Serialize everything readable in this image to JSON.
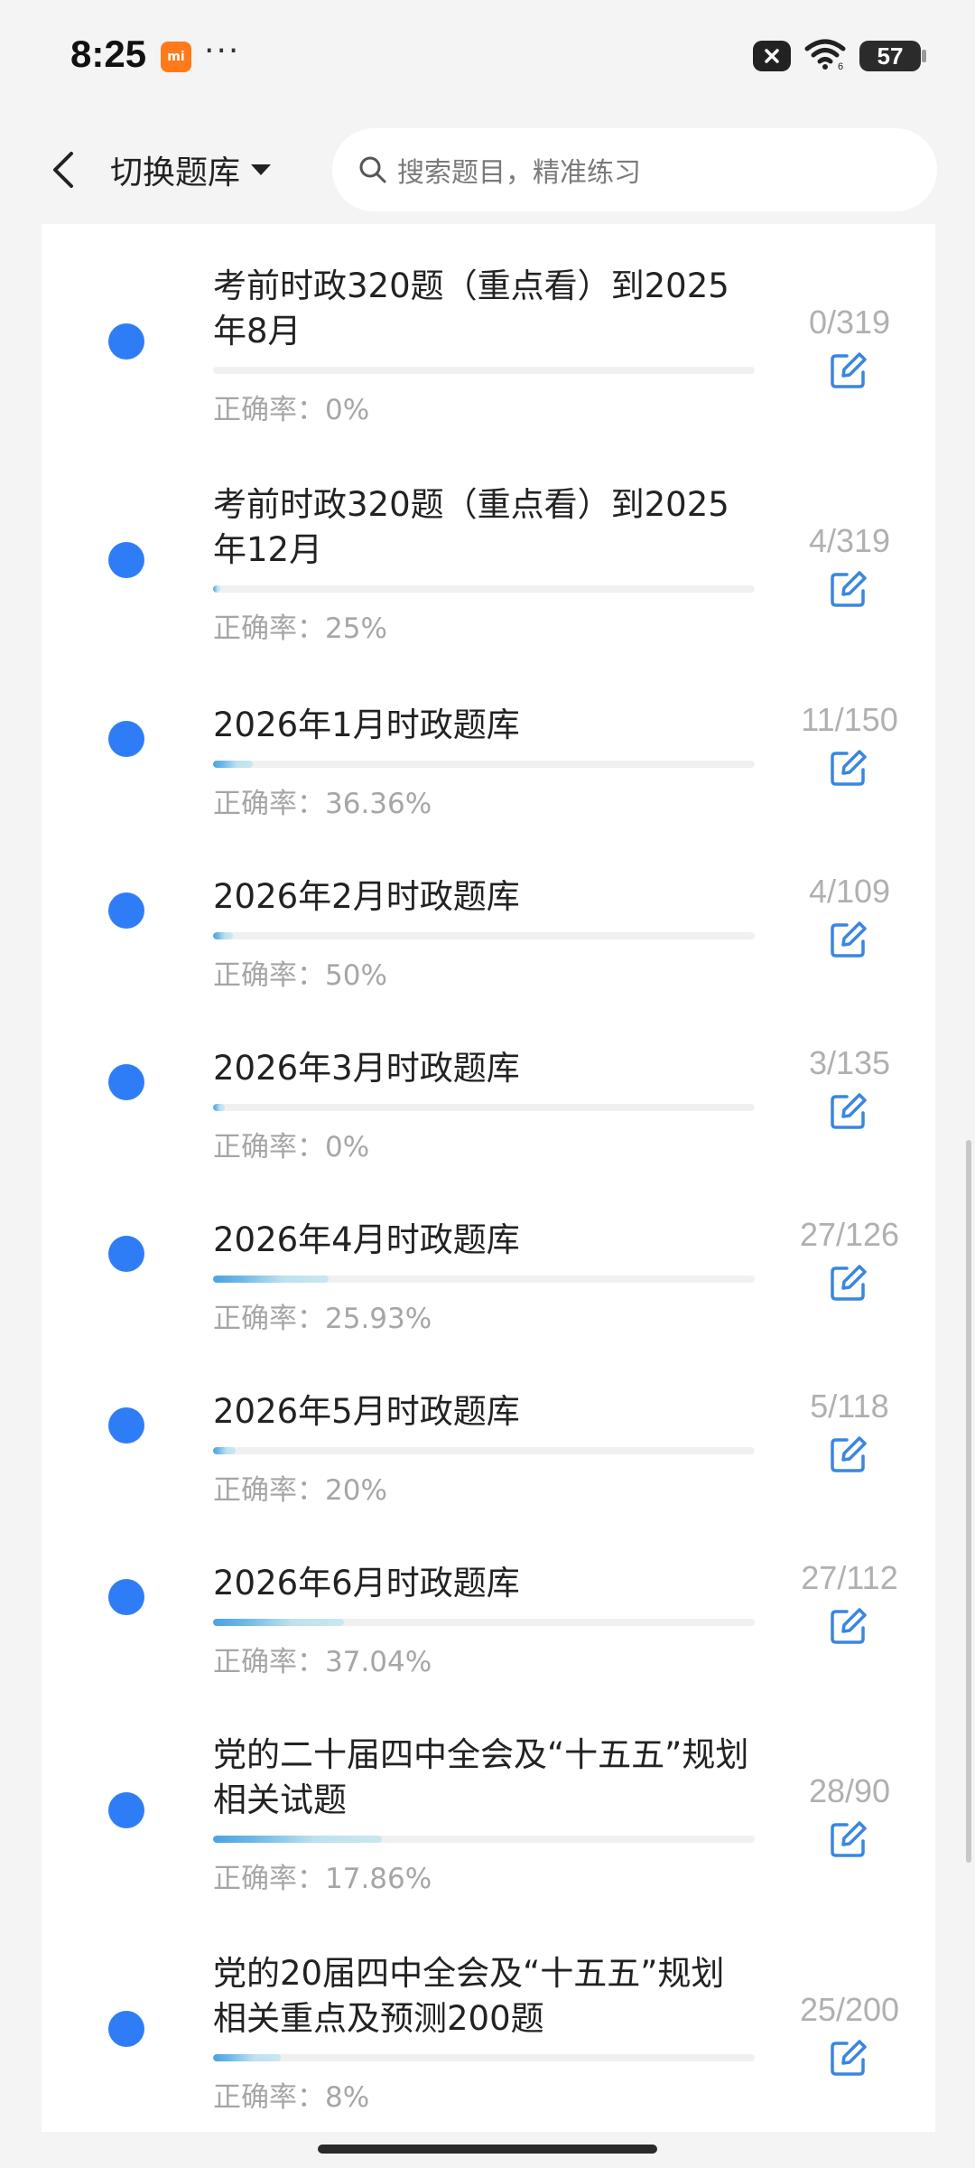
{
  "status_bar": {
    "time": "8:25",
    "app_badge_text": "mi",
    "more": "···",
    "battery": "57"
  },
  "header": {
    "switch_label": "切换题库",
    "search_placeholder": "搜索题目，精准练习"
  },
  "colors": {
    "accent_blue": "#2f7df6",
    "edit_icon_blue": "#3a86e0",
    "muted_text": "#a6a6a6"
  },
  "items": [
    {
      "title": "考前时政320题（重点看）到2025年8月",
      "accuracy": "正确率：0%",
      "count": "0/319",
      "progress": 0.0
    },
    {
      "title": "考前时政320题（重点看）到2025年12月",
      "accuracy": "正确率：25%",
      "count": "4/319",
      "progress": 0.013
    },
    {
      "title": "2026年1月时政题库",
      "accuracy": "正确率：36.36%",
      "count": "11/150",
      "progress": 0.073
    },
    {
      "title": "2026年2月时政题库",
      "accuracy": "正确率：50%",
      "count": "4/109",
      "progress": 0.037
    },
    {
      "title": "2026年3月时政题库",
      "accuracy": "正确率：0%",
      "count": "3/135",
      "progress": 0.022
    },
    {
      "title": "2026年4月时政题库",
      "accuracy": "正确率：25.93%",
      "count": "27/126",
      "progress": 0.214
    },
    {
      "title": "2026年5月时政题库",
      "accuracy": "正确率：20%",
      "count": "5/118",
      "progress": 0.042
    },
    {
      "title": "2026年6月时政题库",
      "accuracy": "正确率：37.04%",
      "count": "27/112",
      "progress": 0.241
    },
    {
      "title": "党的二十届四中全会及“十五五”规划相关试题",
      "accuracy": "正确率：17.86%",
      "count": "28/90",
      "progress": 0.311
    },
    {
      "title": "党的20届四中全会及“十五五”规划相关重点及预测200题",
      "accuracy": "正确率：8%",
      "count": "25/200",
      "progress": 0.125
    }
  ]
}
